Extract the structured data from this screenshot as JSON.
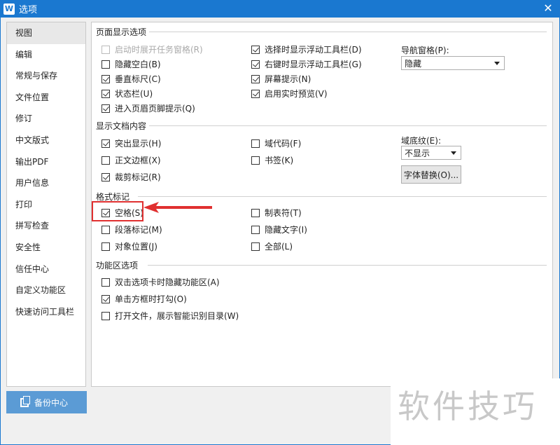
{
  "window": {
    "title": "选项",
    "app_icon": "W",
    "close": "✕"
  },
  "sidebar": {
    "items": [
      {
        "label": "视图",
        "active": true
      },
      {
        "label": "编辑"
      },
      {
        "label": "常规与保存"
      },
      {
        "label": "文件位置"
      },
      {
        "label": "修订"
      },
      {
        "label": "中文版式"
      },
      {
        "label": "输出PDF"
      },
      {
        "label": "用户信息"
      },
      {
        "label": "打印"
      },
      {
        "label": "拼写检查"
      },
      {
        "label": "安全性"
      },
      {
        "label": "信任中心"
      },
      {
        "label": "自定义功能区"
      },
      {
        "label": "快速访问工具栏"
      }
    ],
    "backup_button": "备份中心"
  },
  "sections": {
    "page_display": {
      "title": "页面显示选项",
      "options": [
        {
          "label": "启动时展开任务窗格(R)",
          "checked": false,
          "disabled": true
        },
        {
          "label": "隐藏空白(B)",
          "checked": false
        },
        {
          "label": "垂直标尺(C)",
          "checked": true
        },
        {
          "label": "状态栏(U)",
          "checked": true
        },
        {
          "label": "进入页眉页脚提示(Q)",
          "checked": true
        },
        {
          "label": "选择时显示浮动工具栏(D)",
          "checked": true
        },
        {
          "label": "右键时显示浮动工具栏(G)",
          "checked": true
        },
        {
          "label": "屏幕提示(N)",
          "checked": true
        },
        {
          "label": "启用实时预览(V)",
          "checked": true
        }
      ],
      "nav_pane_label": "导航窗格(P):",
      "nav_pane_value": "隐藏"
    },
    "doc_content": {
      "title": "显示文档内容",
      "options": [
        {
          "label": "突出显示(H)",
          "checked": true
        },
        {
          "label": "正文边框(X)",
          "checked": false
        },
        {
          "label": "裁剪标记(R)",
          "checked": true
        },
        {
          "label": "域代码(F)",
          "checked": false
        },
        {
          "label": "书签(K)",
          "checked": false
        }
      ],
      "field_shading_label": "域底纹(E):",
      "field_shading_value": "不显示",
      "font_sub_button": "字体替换(O)..."
    },
    "format_marks": {
      "title": "格式标记",
      "options": [
        {
          "label": "空格(S)",
          "checked": true
        },
        {
          "label": "段落标记(M)",
          "checked": false
        },
        {
          "label": "对象位置(J)",
          "checked": false
        },
        {
          "label": "制表符(T)",
          "checked": false
        },
        {
          "label": "隐藏文字(I)",
          "checked": false
        },
        {
          "label": "全部(L)",
          "checked": false
        }
      ]
    },
    "ribbon": {
      "title": "功能区选项",
      "options": [
        {
          "label": "双击选项卡时隐藏功能区(A)",
          "checked": false
        },
        {
          "label": "单击方框时打勾(O)",
          "checked": true
        },
        {
          "label": "打开文件，展示智能识别目录(W)",
          "checked": false
        }
      ]
    }
  },
  "watermark": "软件技巧",
  "colors": {
    "titlebar": "#1a78d0",
    "accent": "#5b9bd5",
    "highlight": "#e03030"
  }
}
